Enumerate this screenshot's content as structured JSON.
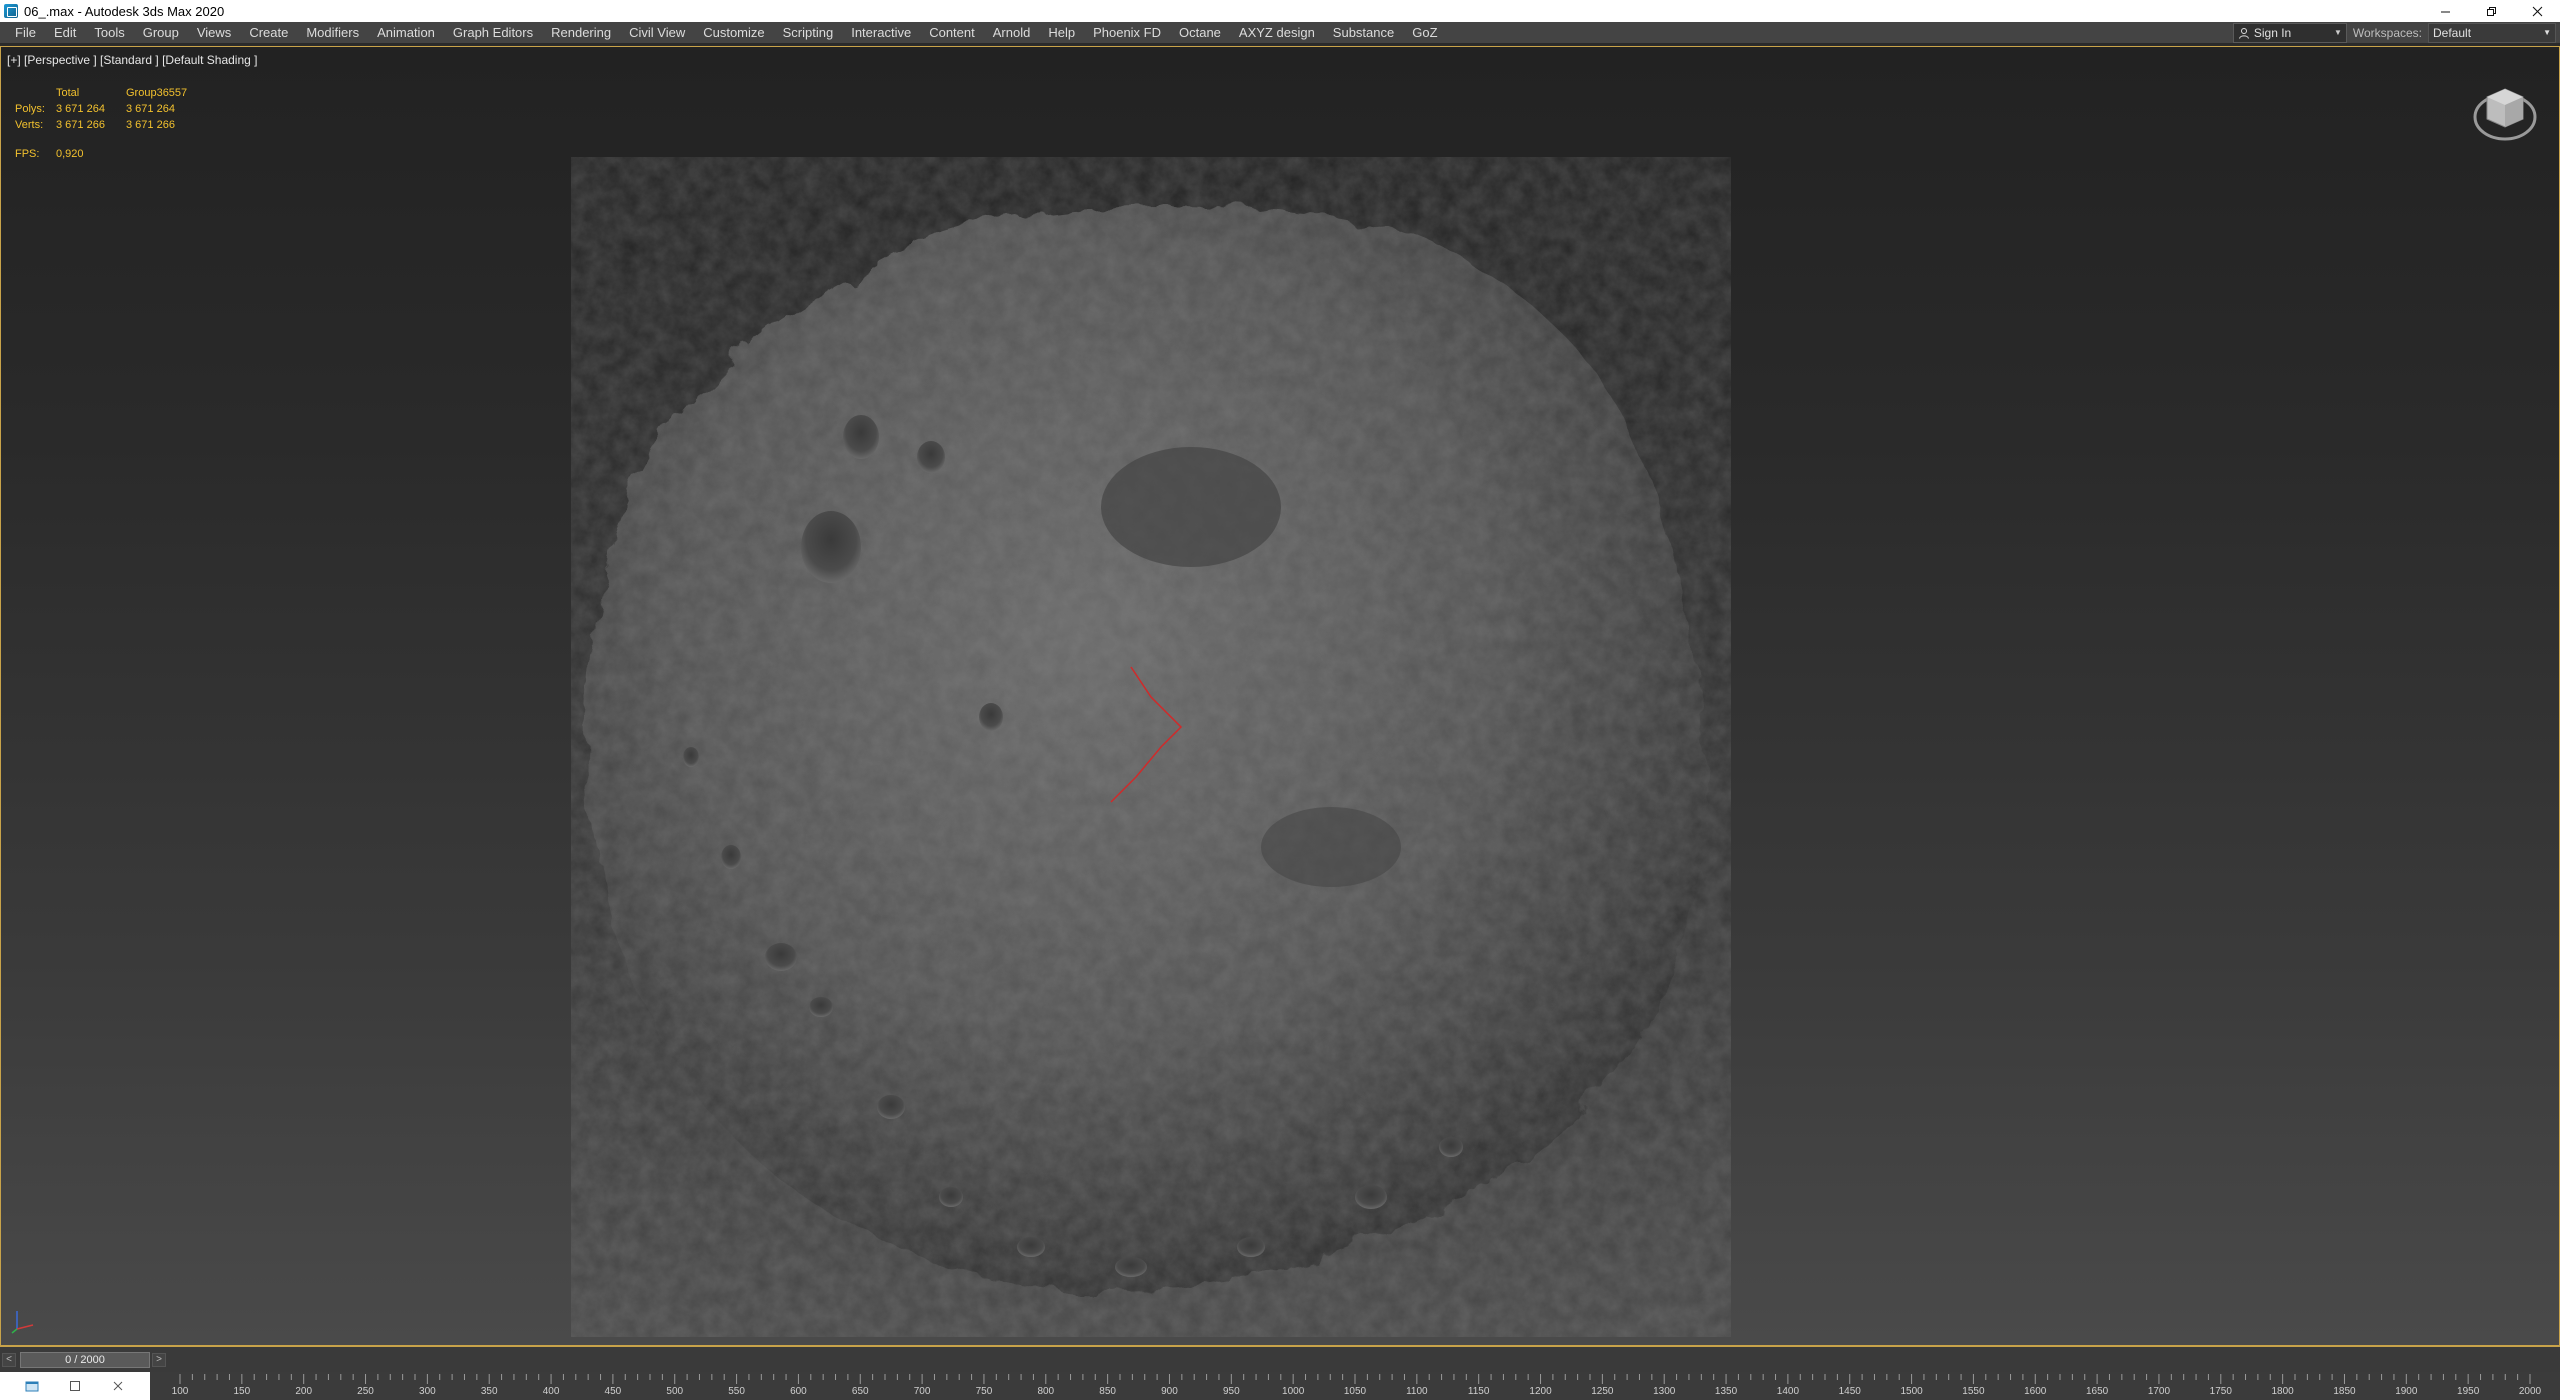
{
  "window": {
    "title": "06_.max - Autodesk 3ds Max 2020"
  },
  "menu": {
    "items": [
      "File",
      "Edit",
      "Tools",
      "Group",
      "Views",
      "Create",
      "Modifiers",
      "Animation",
      "Graph Editors",
      "Rendering",
      "Civil View",
      "Customize",
      "Scripting",
      "Interactive",
      "Content",
      "Arnold",
      "Help",
      "Phoenix FD",
      "Octane",
      "AXYZ design",
      "Substance",
      "GoZ"
    ],
    "sign_in": "Sign In",
    "workspaces_label": "Workspaces:",
    "workspaces_value": "Default"
  },
  "viewport": {
    "label": "[+] [Perspective ] [Standard ] [Default Shading ]",
    "stats": {
      "header_total": "Total",
      "header_object": "Group36557",
      "polys_label": "Polys:",
      "polys_total": "3 671 264",
      "polys_object": "3 671 264",
      "verts_label": "Verts:",
      "verts_total": "3 671 266",
      "verts_object": "3 671 266",
      "fps_label": "FPS:",
      "fps_value": "0,920"
    }
  },
  "timeslider": {
    "frame_display": "0 / 2000",
    "prev": "<",
    "next": ">"
  },
  "trackbar": {
    "tick_labels": [
      "100",
      "150",
      "200",
      "250",
      "300",
      "350",
      "400",
      "450",
      "500",
      "550",
      "600",
      "650",
      "700",
      "750",
      "800",
      "850",
      "900",
      "950",
      "1000",
      "1050",
      "1100",
      "1150",
      "1200",
      "1250",
      "1300",
      "1350",
      "1400",
      "1450",
      "1500",
      "1550",
      "1600",
      "1650",
      "1700",
      "1750",
      "1800",
      "1850",
      "1900",
      "1950",
      "2000"
    ]
  },
  "colors": {
    "accent_border": "#c8a34a",
    "stats_text": "#f2c12e",
    "menu_bg": "#444444"
  }
}
